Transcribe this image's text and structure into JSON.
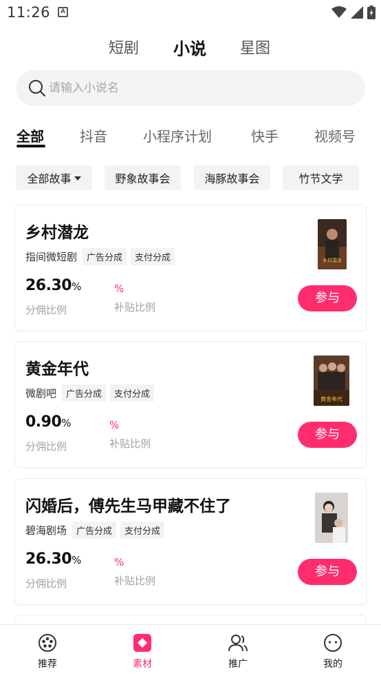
{
  "status_bar": {
    "time": "11:26",
    "notification": "A",
    "icons": [
      "wifi-icon",
      "signal-icon",
      "battery-icon"
    ]
  },
  "top_tabs": [
    {
      "label": "短剧",
      "active": false
    },
    {
      "label": "小说",
      "active": true
    },
    {
      "label": "星图",
      "active": false
    }
  ],
  "search": {
    "placeholder": "请输入小说名"
  },
  "category_tabs": [
    {
      "label": "全部",
      "active": true
    },
    {
      "label": "抖音",
      "active": false
    },
    {
      "label": "小程序计划",
      "active": false
    },
    {
      "label": "快手",
      "active": false
    },
    {
      "label": "视频号",
      "active": false
    }
  ],
  "filters": [
    {
      "label": "全部故事",
      "dropdown": true
    },
    {
      "label": "野象故事会",
      "dropdown": false
    },
    {
      "label": "海豚故事会",
      "dropdown": false
    },
    {
      "label": "竹节文学",
      "dropdown": false
    }
  ],
  "cards": [
    {
      "title": "乡村潜龙",
      "source": "指间微短剧",
      "tags": [
        "广告分成",
        "支付分成"
      ],
      "rate": "26.30",
      "rate_unit": "%",
      "rate_label": "分佣比例",
      "subsidy_unit": "%",
      "subsidy_label": "补贴比例",
      "button": "参与",
      "cover_text": "乡村潜龙"
    },
    {
      "title": "黄金年代",
      "source": "微剧吧",
      "tags": [
        "广告分成",
        "支付分成"
      ],
      "rate": "0.90",
      "rate_unit": "%",
      "rate_label": "分佣比例",
      "subsidy_unit": "%",
      "subsidy_label": "补贴比例",
      "button": "参与",
      "cover_text": "黄金年代"
    },
    {
      "title": "闪婚后，傅先生马甲藏不住了",
      "source": "碧海剧场",
      "tags": [
        "广告分成",
        "支付分成"
      ],
      "rate": "26.30",
      "rate_unit": "%",
      "rate_label": "分佣比例",
      "subsidy_unit": "%",
      "subsidy_label": "补贴比例",
      "button": "参与",
      "cover_text": ""
    }
  ],
  "bottom_nav": [
    {
      "label": "推荐",
      "icon": "film-reel-icon",
      "active": false
    },
    {
      "label": "素材",
      "icon": "material-icon",
      "active": true
    },
    {
      "label": "推广",
      "icon": "users-icon",
      "active": false
    },
    {
      "label": "我的",
      "icon": "smiley-icon",
      "active": false
    }
  ],
  "colors": {
    "accent": "#ff2d6e",
    "chip_bg": "#f3f3f5",
    "muted_text": "#a3a3a3"
  }
}
